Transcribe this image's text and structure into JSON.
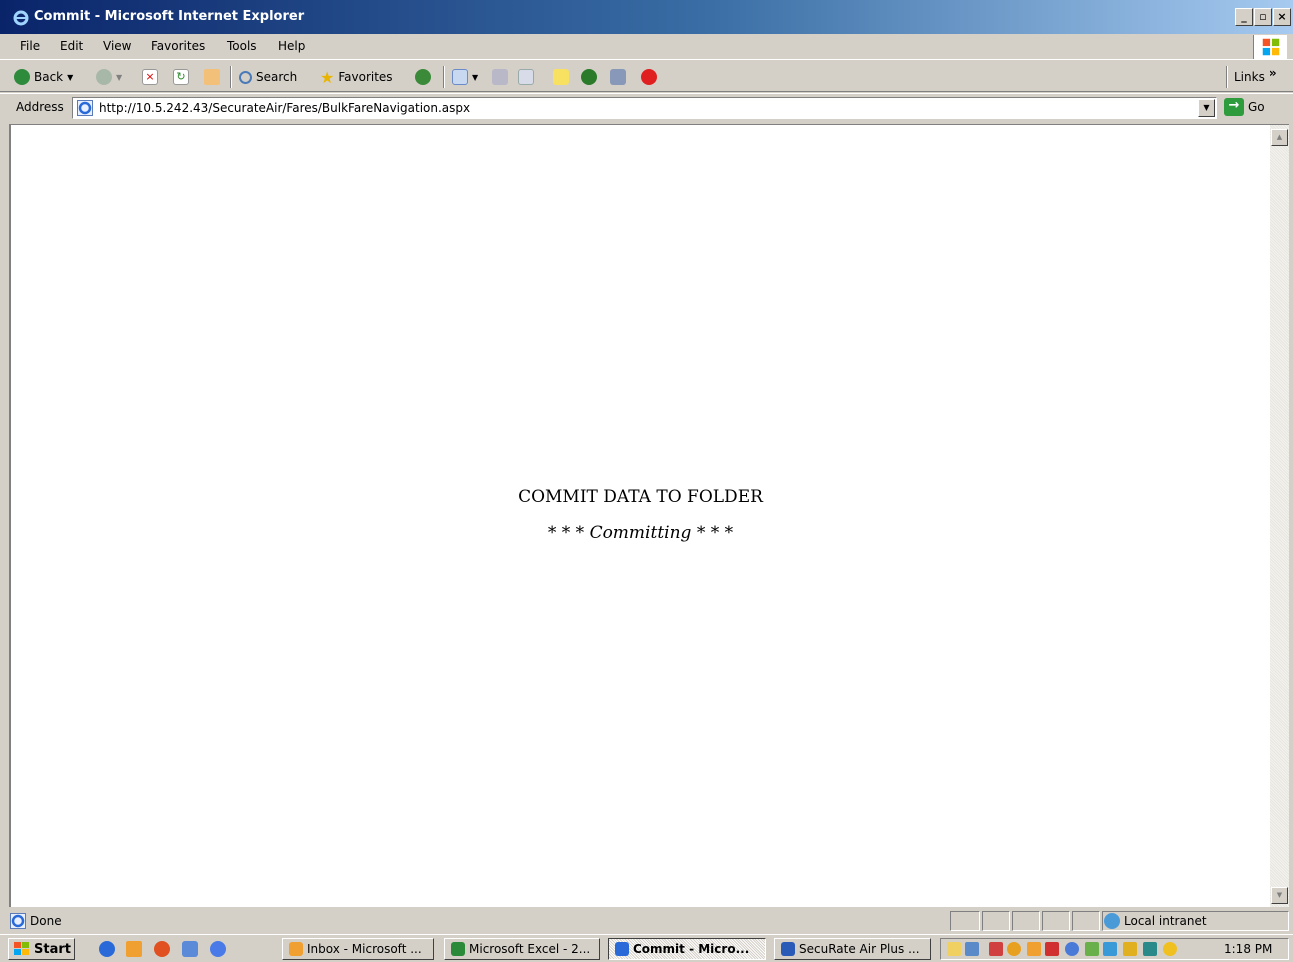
{
  "window": {
    "title": "Commit - Microsoft Internet Explorer",
    "minimize": "_",
    "maximize": "▫",
    "close": "×"
  },
  "menu": [
    "File",
    "Edit",
    "View",
    "Favorites",
    "Tools",
    "Help"
  ],
  "toolbar": {
    "back_label": "Back",
    "search_label": "Search",
    "favorites_label": "Favorites",
    "links_label": "Links",
    "links_chevron": "»"
  },
  "address": {
    "label": "Address",
    "url": "http://10.5.242.43/SecurateAir/Fares/BulkFareNavigation.aspx",
    "go_label": "Go"
  },
  "content": {
    "heading": "COMMIT DATA TO FOLDER",
    "status_prefix": "* * * ",
    "status_word": "Committing",
    "status_suffix": " * * *"
  },
  "statusbar": {
    "status_text": "Done",
    "zone_label": "Local intranet"
  },
  "taskbar": {
    "start_label": "Start",
    "tasks": [
      {
        "label": "Inbox - Microsoft ...",
        "icon": "outlook-icon"
      },
      {
        "label": "Microsoft Excel - 2...",
        "icon": "excel-icon"
      },
      {
        "label": "Commit - Micro...",
        "icon": "ie-icon",
        "active": true
      },
      {
        "label": "SecuRate Air Plus ...",
        "icon": "word-icon"
      }
    ],
    "clock": "1:18 PM"
  },
  "colors": {
    "titlebar_start": "#0a246a",
    "titlebar_end": "#a6caf0",
    "chrome": "#d4d0c8"
  }
}
